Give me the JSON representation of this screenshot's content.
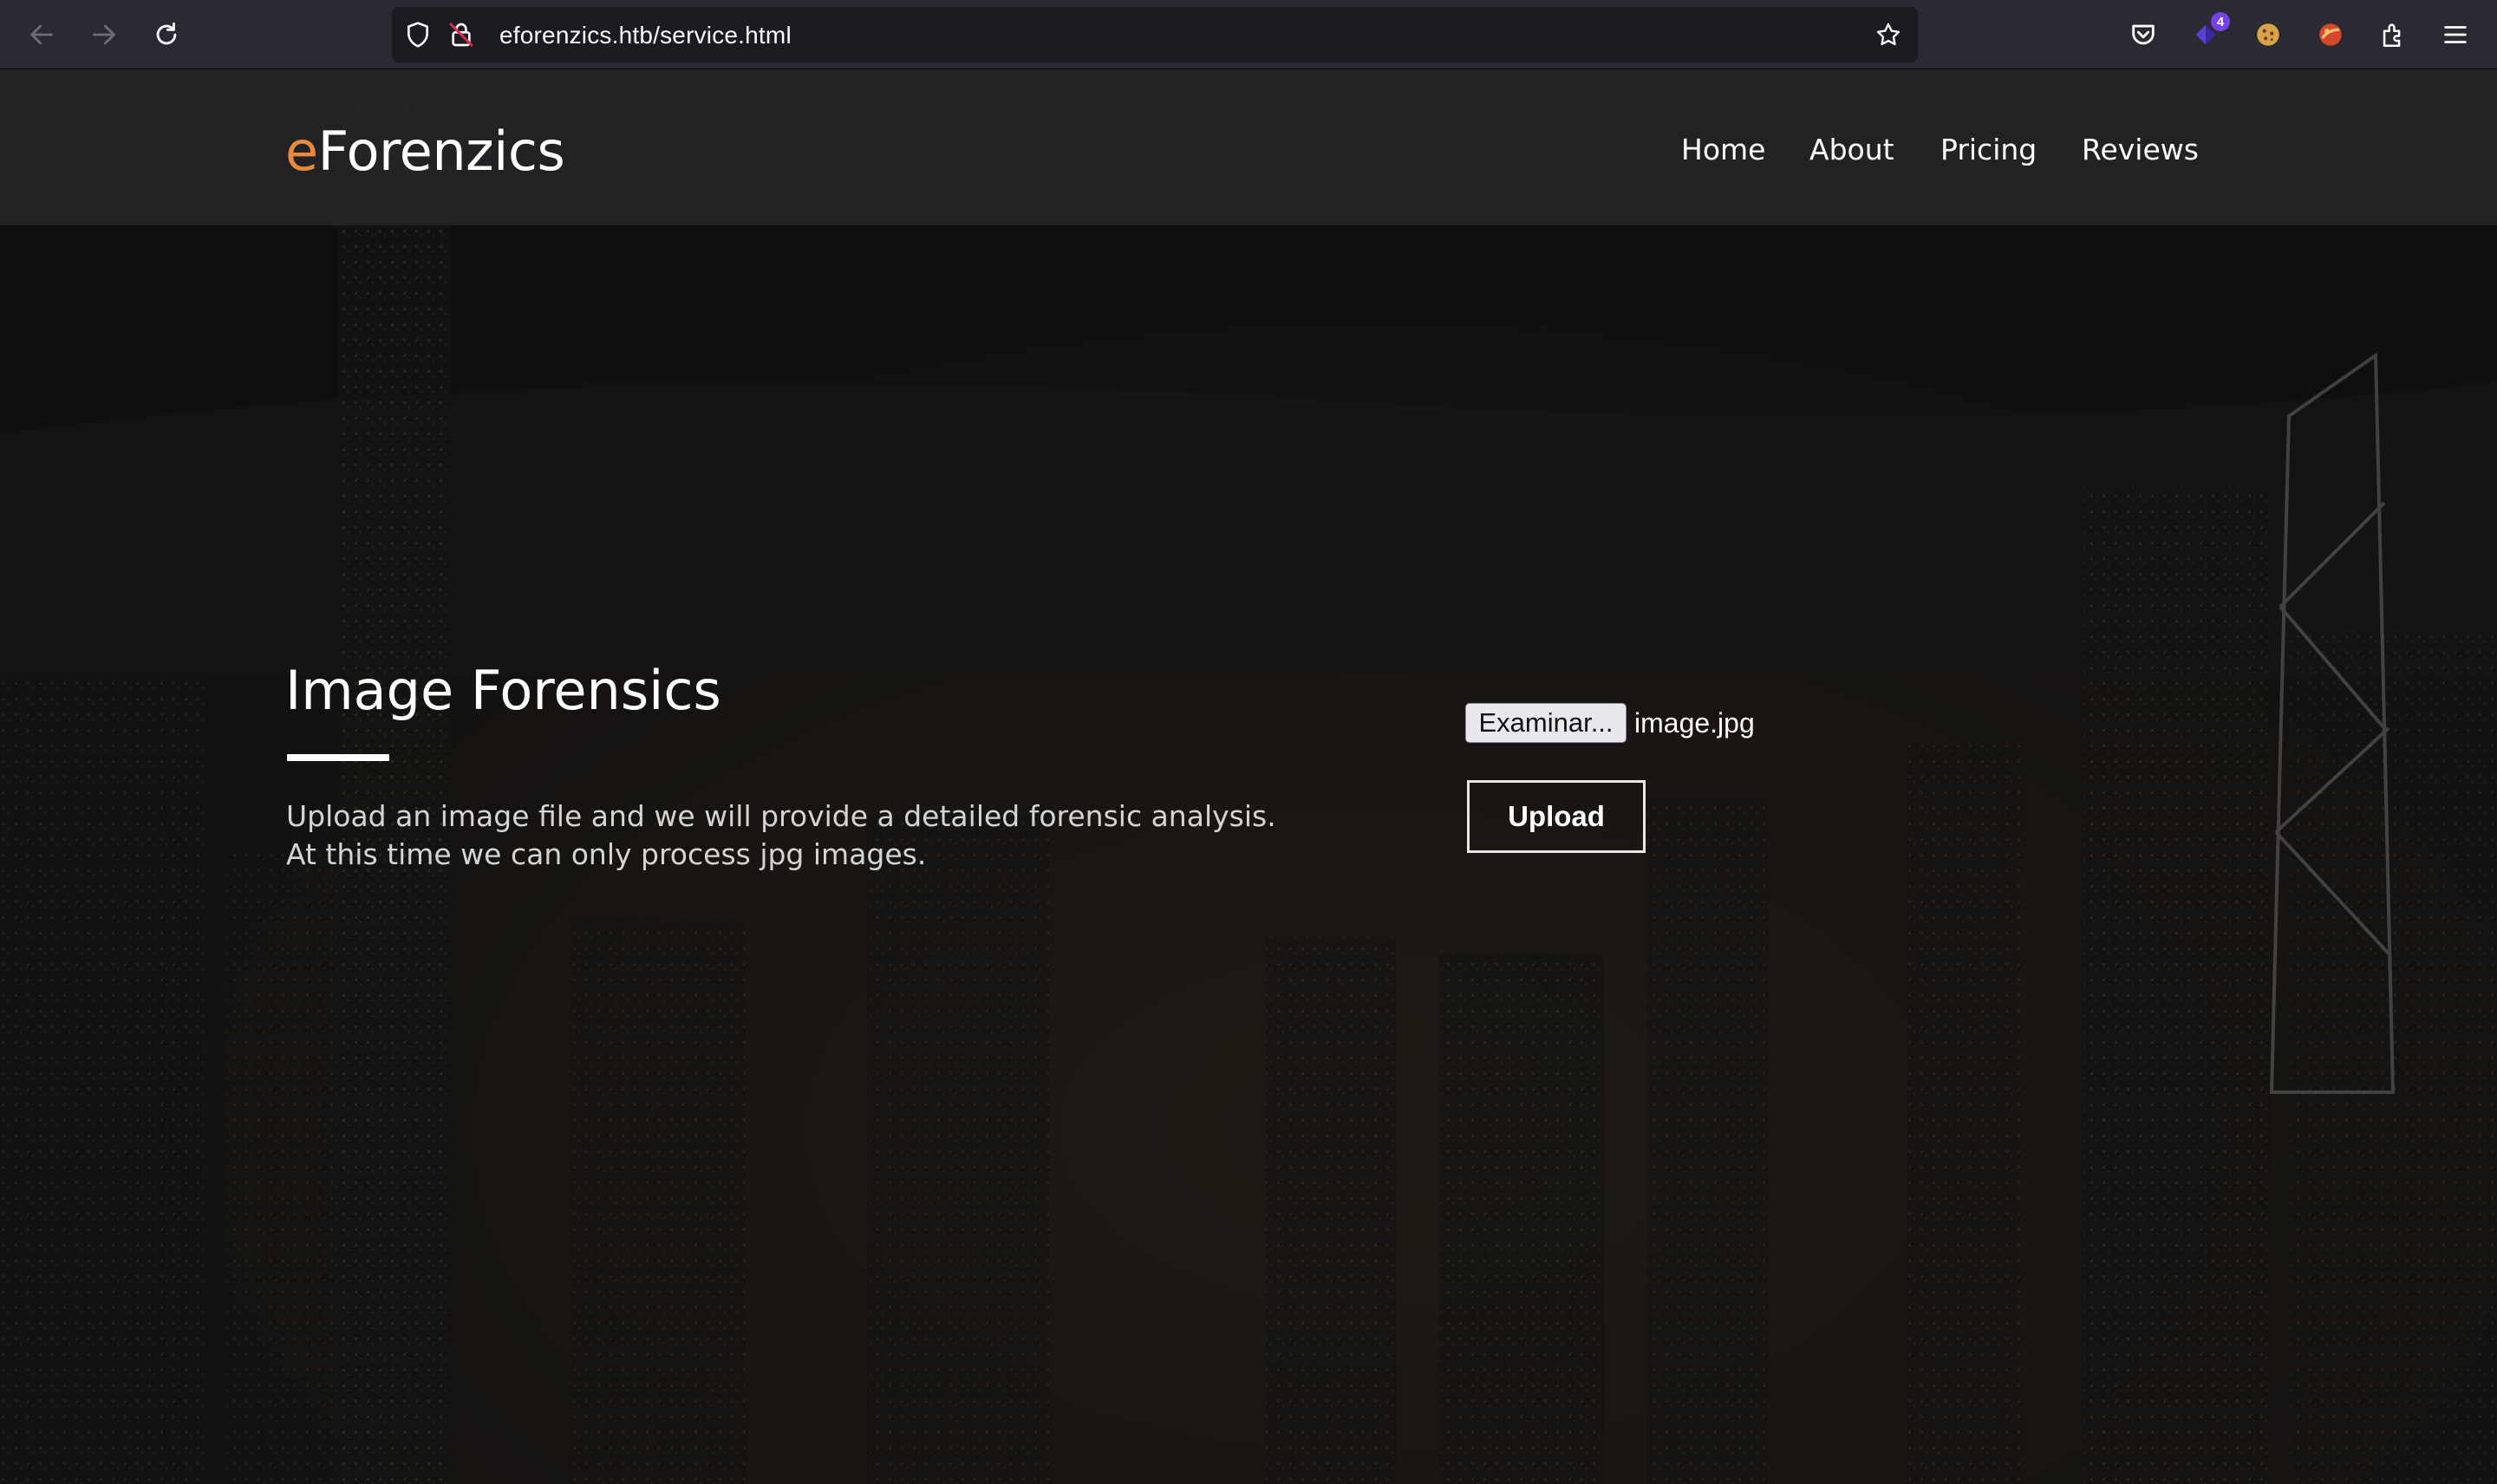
{
  "browser": {
    "url": "eforenzics.htb/service.html",
    "extension_badge": "4",
    "icons": [
      "back-icon",
      "forward-icon",
      "reload-icon",
      "shield-icon",
      "lock-slash-icon",
      "star-icon",
      "pocket-icon",
      "extension-icon",
      "cookie-icon",
      "extension-icon",
      "puzzle-icon",
      "menu-icon"
    ]
  },
  "site": {
    "logo_prefix": "e",
    "logo_rest": "Forenzics",
    "accent_color": "#e9893e",
    "nav": [
      "Home",
      "About",
      "Pricing",
      "Reviews"
    ]
  },
  "main": {
    "title": "Image Forensics",
    "description_line1": "Upload an image file and we will provide a detailed forensic analysis.",
    "description_line2": "At this time we can only process jpg images.",
    "file_button_label": "Examinar...",
    "file_name": "image.jpg",
    "upload_label": "Upload"
  }
}
